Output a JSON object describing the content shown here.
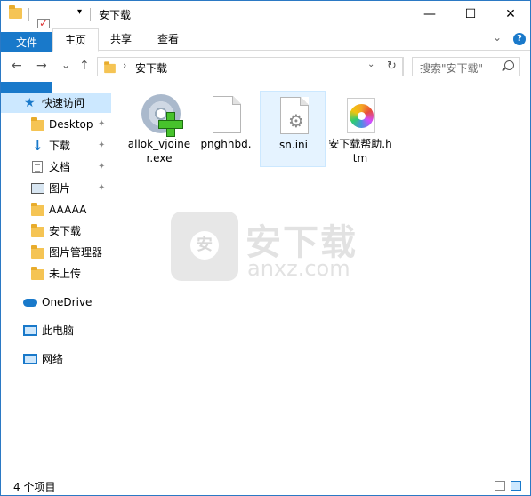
{
  "window": {
    "title": "安下载",
    "controls": {
      "minimize": "—",
      "maximize": "☐",
      "close": "✕"
    }
  },
  "ribbon": {
    "tabs": [
      {
        "label": "文件",
        "active": false,
        "is_file": true
      },
      {
        "label": "主页",
        "active": true
      },
      {
        "label": "共享",
        "active": false
      },
      {
        "label": "查看",
        "active": false
      }
    ],
    "expand_icon": "chevron-down-icon",
    "help_icon": "?"
  },
  "address": {
    "back": "←",
    "forward": "→",
    "recent": "⌄",
    "up": "↑",
    "path_separator": "›",
    "path": "安下载",
    "dropdown": "⌄",
    "refresh": "↻",
    "search_placeholder": "搜索\"安下载\""
  },
  "sidebar": {
    "items": [
      {
        "label": "快速访问",
        "icon": "star-icon",
        "pinned": false,
        "selected": true
      },
      {
        "label": "Desktop",
        "icon": "folder-icon",
        "pinned": true
      },
      {
        "label": "下载",
        "icon": "download-icon",
        "pinned": true
      },
      {
        "label": "文档",
        "icon": "document-icon",
        "pinned": true
      },
      {
        "label": "图片",
        "icon": "picture-icon",
        "pinned": true
      },
      {
        "label": "AAAAA",
        "icon": "folder-icon",
        "pinned": false
      },
      {
        "label": "安下载",
        "icon": "folder-icon",
        "pinned": false
      },
      {
        "label": "图片管理器",
        "icon": "folder-icon",
        "pinned": false
      },
      {
        "label": "未上传",
        "icon": "folder-icon",
        "pinned": false
      },
      {
        "label": "OneDrive",
        "icon": "cloud-icon",
        "pinned": false
      },
      {
        "label": "此电脑",
        "icon": "computer-icon",
        "pinned": false
      },
      {
        "label": "网络",
        "icon": "network-icon",
        "pinned": false
      }
    ],
    "pin_glyph": "📌"
  },
  "files": [
    {
      "name": "allok_vjoiner.exe",
      "icon": "disc-plus-icon",
      "selected": false
    },
    {
      "name": "pnghhbd.",
      "icon": "blank-file-icon",
      "selected": false
    },
    {
      "name": "sn.ini",
      "icon": "settings-file-icon",
      "selected": true
    },
    {
      "name": "安下载帮助.htm",
      "icon": "html-file-icon",
      "selected": false
    }
  ],
  "watermark": {
    "title": "安下载",
    "subtitle": "anxz.com"
  },
  "status": {
    "item_count": "4 个项目"
  },
  "colors": {
    "accent": "#1979ca",
    "selection": "#cce8ff",
    "folder": "#f5c454"
  }
}
